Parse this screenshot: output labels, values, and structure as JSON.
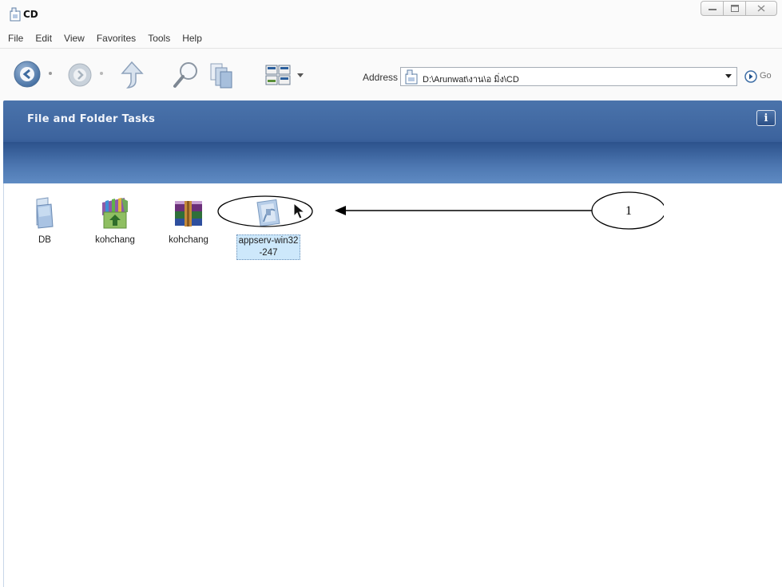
{
  "window": {
    "title": "CD"
  },
  "menu": {
    "items": [
      "File",
      "Edit",
      "View",
      "Favorites",
      "Tools",
      "Help"
    ]
  },
  "toolbar": {
    "address_label": "Address",
    "address_value": "D:\\Arunwat\\งาน\\อ มิ่ง\\CD",
    "go_label": "Go"
  },
  "task_pane": {
    "title": "File and Folder Tasks",
    "info_glyph": "i"
  },
  "files": [
    {
      "name": "DB",
      "icon": "folder-icon",
      "selected": false
    },
    {
      "name": "kohchang",
      "icon": "archive-extract-icon",
      "selected": false
    },
    {
      "name": "kohchang",
      "icon": "winrar-archive-icon",
      "selected": false
    },
    {
      "name": "appserv-win32\n-247",
      "line1": "appserv-win32",
      "line2": "-247",
      "icon": "installer-icon",
      "selected": true
    }
  ],
  "annotation": {
    "number": "1"
  },
  "colors": {
    "task_pane_blue": "#3d649e",
    "selection_fill": "#cde8fb"
  }
}
